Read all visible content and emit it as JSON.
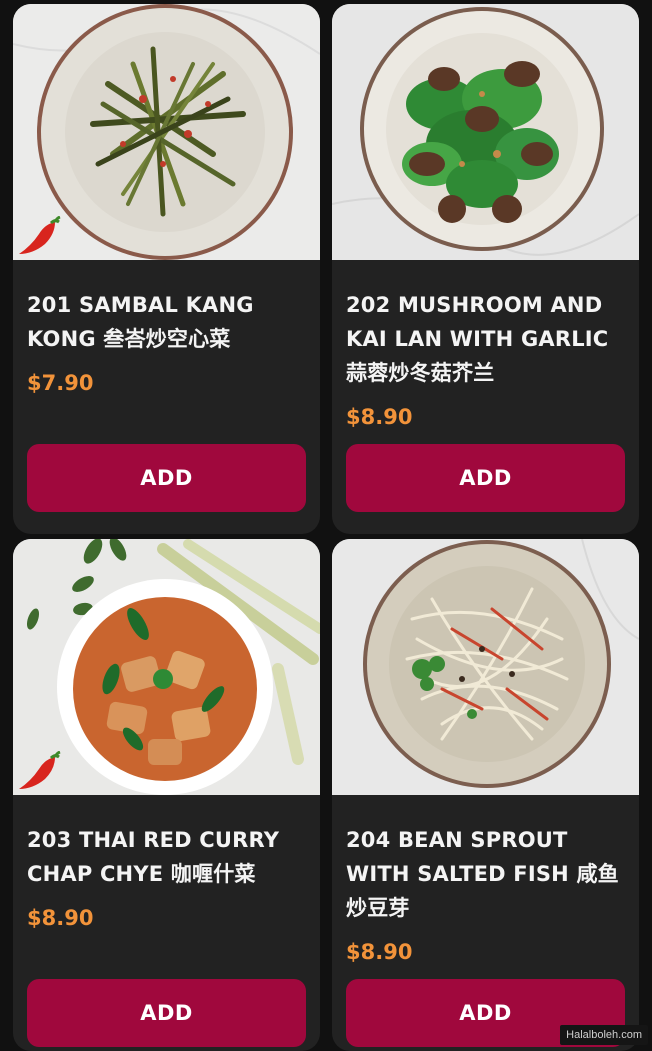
{
  "menu": {
    "items": [
      {
        "title": "201 SAMBAL KANG KONG 叁峇炒空心菜",
        "price": "$7.90",
        "add_label": "ADD",
        "spicy": true,
        "dish_icon": "kang-kong-plate"
      },
      {
        "title": "202 MUSHROOM AND KAI LAN WITH GARLIC 蒜蓉炒冬菇芥兰",
        "price": "$8.90",
        "add_label": "ADD",
        "spicy": false,
        "dish_icon": "kai-lan-plate"
      },
      {
        "title": "203 THAI RED CURRY CHAP CHYE 咖喱什菜",
        "price": "$8.90",
        "add_label": "ADD",
        "spicy": true,
        "dish_icon": "red-curry-bowl"
      },
      {
        "title": "204 BEAN SPROUT WITH SALTED FISH 咸鱼炒豆芽",
        "price": "$8.90",
        "add_label": "ADD",
        "spicy": false,
        "dish_icon": "bean-sprout-plate"
      }
    ]
  },
  "watermark": "Halalboleh.com",
  "colors": {
    "background": "#111111",
    "card": "#222222",
    "price": "#f2933a",
    "button": "#a0083d",
    "text": "#f4f4f4"
  }
}
